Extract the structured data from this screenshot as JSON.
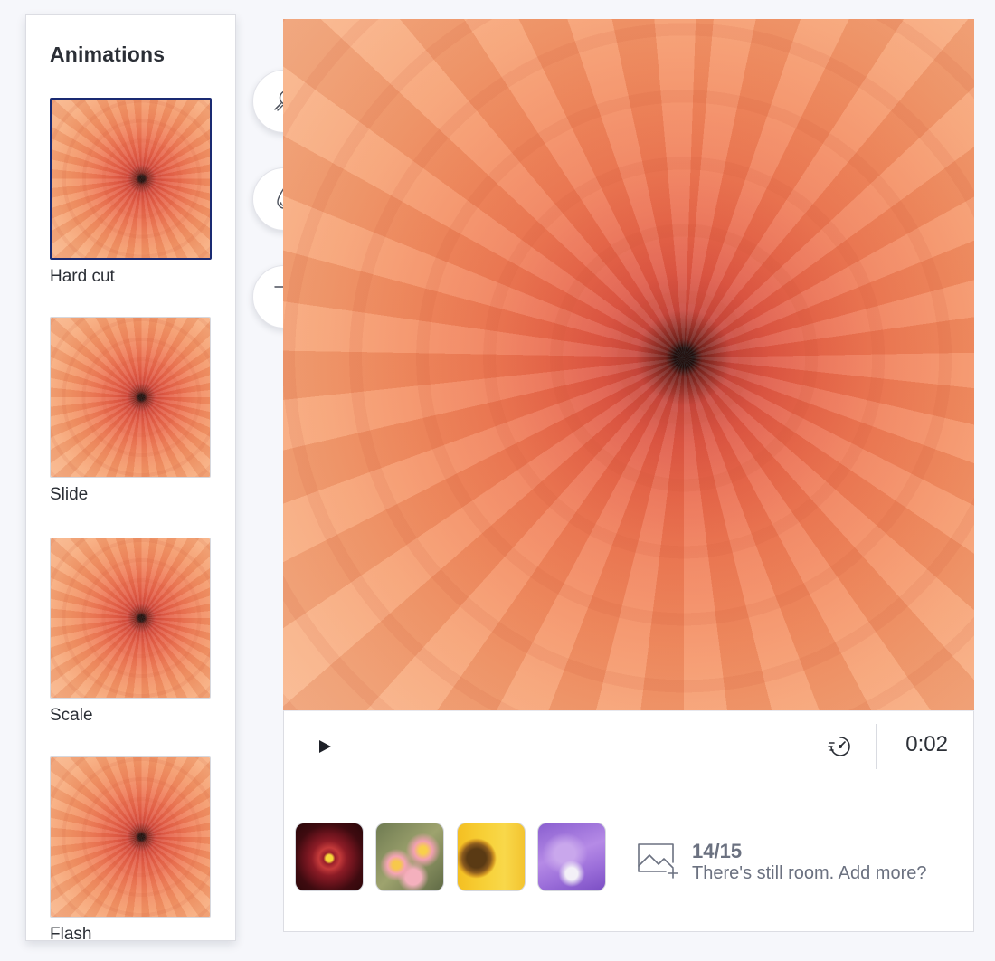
{
  "panel": {
    "title": "Animations",
    "items": [
      {
        "label": "Hard cut",
        "selected": true
      },
      {
        "label": "Slide",
        "selected": false
      },
      {
        "label": "Scale",
        "selected": false
      },
      {
        "label": "Flash",
        "selected": false
      }
    ]
  },
  "tools": [
    {
      "icon": "sticker-icon"
    },
    {
      "icon": "color-drop-icon"
    },
    {
      "icon": "text-icon"
    }
  ],
  "player": {
    "play_icon": "play-icon",
    "speed_icon": "speedometer-icon",
    "time": "0:02"
  },
  "strip": {
    "thumbnails": [
      "dark red flower",
      "pink plumeria",
      "sunflower",
      "purple flower"
    ],
    "count": "14/15",
    "hint": "There's still room. Add more?",
    "add_icon": "add-photo-icon"
  },
  "colors": {
    "selected_border": "#1a2a72",
    "text": "#2b2f36",
    "muted_text": "#6b7180",
    "background": "#f6f7fb"
  }
}
